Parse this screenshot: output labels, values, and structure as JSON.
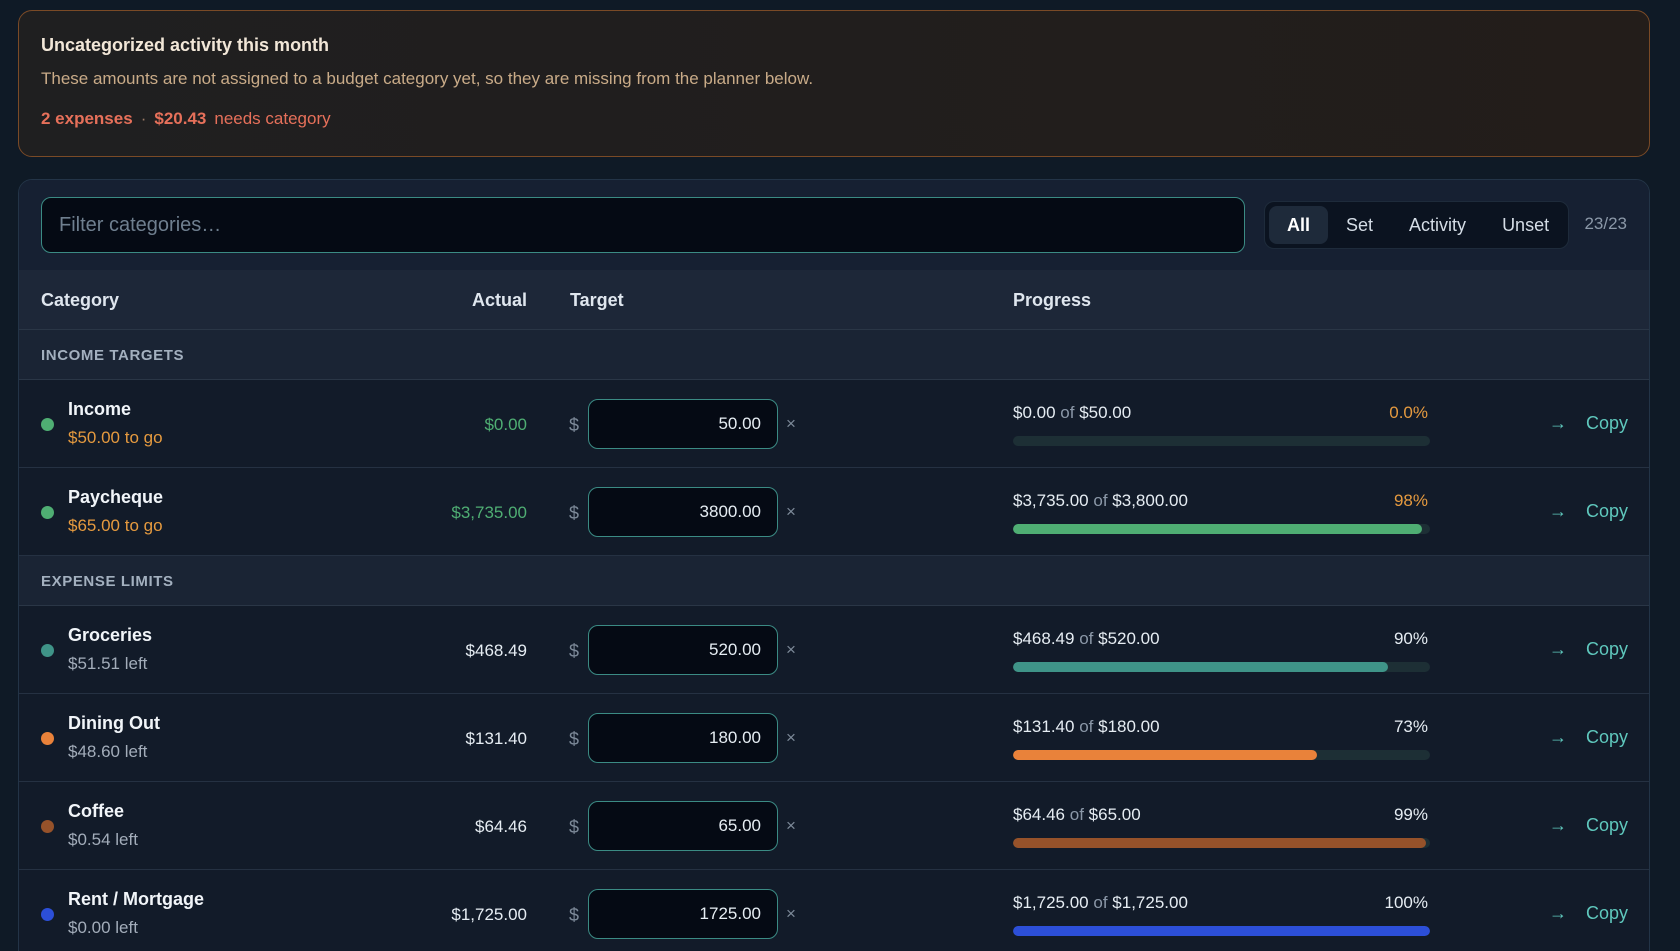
{
  "banner": {
    "title": "Uncategorized activity this month",
    "description": "These amounts are not assigned to a budget category yet, so they are missing from the planner below.",
    "count": "2 expenses",
    "separator": "·",
    "amount": "$20.43",
    "suffix": "needs category"
  },
  "toolbar": {
    "filter_placeholder": "Filter categories…",
    "filter_value": "",
    "segments": [
      "All",
      "Set",
      "Activity",
      "Unset"
    ],
    "active_segment": "All",
    "count": "23/23"
  },
  "columns": {
    "category": "Category",
    "actual": "Actual",
    "target": "Target",
    "progress": "Progress"
  },
  "colors": {
    "income_green": "#4fae73",
    "warn_orange": "#e59a3f",
    "accent_teal": "#5fc8bd"
  },
  "sections": [
    {
      "label": "INCOME TARGETS",
      "rows": [
        {
          "name": "Income",
          "status": "$50.00 to go",
          "status_warn": true,
          "actual": "$0.00",
          "actual_green": true,
          "currency": "$",
          "target": "50.00",
          "clear": "×",
          "progress_actual": "$0.00",
          "progress_of": "of",
          "progress_target": "$50.00",
          "percent": "0.0%",
          "percent_warn": true,
          "fill": 0.0,
          "color": "#4fae73",
          "arrow": "→",
          "copy": "Copy"
        },
        {
          "name": "Paycheque",
          "status": "$65.00 to go",
          "status_warn": true,
          "actual": "$3,735.00",
          "actual_green": true,
          "currency": "$",
          "target": "3800.00",
          "clear": "×",
          "progress_actual": "$3,735.00",
          "progress_of": "of",
          "progress_target": "$3,800.00",
          "percent": "98%",
          "percent_warn": true,
          "fill": 0.98,
          "color": "#4fae73",
          "arrow": "→",
          "copy": "Copy"
        }
      ]
    },
    {
      "label": "EXPENSE LIMITS",
      "rows": [
        {
          "name": "Groceries",
          "status": "$51.51 left",
          "status_warn": false,
          "actual": "$468.49",
          "actual_green": false,
          "currency": "$",
          "target": "520.00",
          "clear": "×",
          "progress_actual": "$468.49",
          "progress_of": "of",
          "progress_target": "$520.00",
          "percent": "90%",
          "percent_warn": false,
          "fill": 0.9,
          "color": "#3f9488",
          "arrow": "→",
          "copy": "Copy"
        },
        {
          "name": "Dining Out",
          "status": "$48.60 left",
          "status_warn": false,
          "actual": "$131.40",
          "actual_green": false,
          "currency": "$",
          "target": "180.00",
          "clear": "×",
          "progress_actual": "$131.40",
          "progress_of": "of",
          "progress_target": "$180.00",
          "percent": "73%",
          "percent_warn": false,
          "fill": 0.73,
          "color": "#e9823a",
          "arrow": "→",
          "copy": "Copy"
        },
        {
          "name": "Coffee",
          "status": "$0.54 left",
          "status_warn": false,
          "actual": "$64.46",
          "actual_green": false,
          "currency": "$",
          "target": "65.00",
          "clear": "×",
          "progress_actual": "$64.46",
          "progress_of": "of",
          "progress_target": "$65.00",
          "percent": "99%",
          "percent_warn": false,
          "fill": 0.99,
          "color": "#96522a",
          "arrow": "→",
          "copy": "Copy"
        },
        {
          "name": "Rent / Mortgage",
          "status": "$0.00 left",
          "status_warn": false,
          "actual": "$1,725.00",
          "actual_green": false,
          "currency": "$",
          "target": "1725.00",
          "clear": "×",
          "progress_actual": "$1,725.00",
          "progress_of": "of",
          "progress_target": "$1,725.00",
          "percent": "100%",
          "percent_warn": false,
          "fill": 1.0,
          "color": "#2c4fd8",
          "arrow": "→",
          "copy": "Copy"
        }
      ]
    }
  ]
}
